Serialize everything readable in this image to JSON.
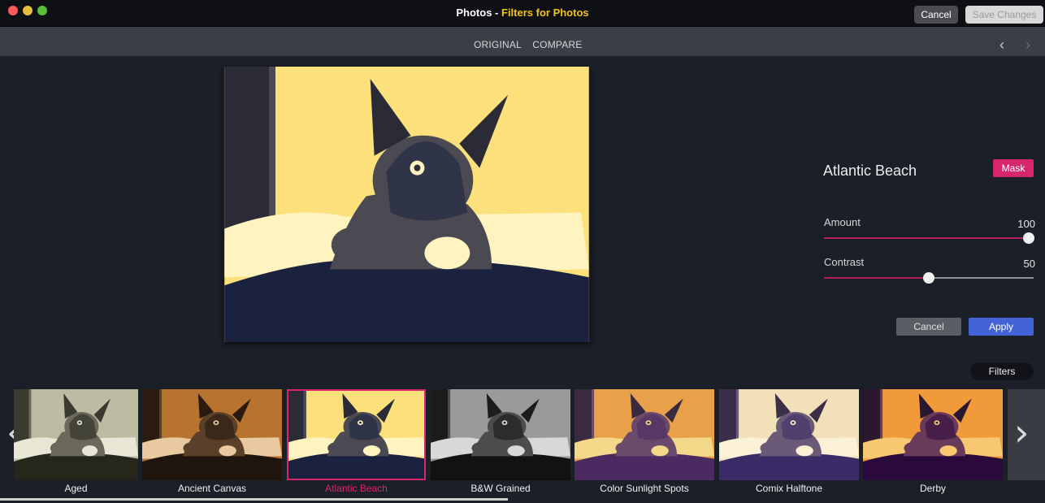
{
  "window": {
    "app_name": "Photos",
    "separator": " - ",
    "plugin_name": "Filters for Photos",
    "cancel_label": "Cancel",
    "save_label": "Save Changes"
  },
  "toolbar": {
    "tab_original": "ORIGINAL",
    "tab_compare": "COMPARE",
    "prev_icon": "‹",
    "next_icon": "›"
  },
  "panel": {
    "filter_name": "Atlantic Beach",
    "mask_label": "Mask",
    "amount": {
      "label": "Amount",
      "value": "100",
      "level": 1.0
    },
    "contrast": {
      "label": "Contrast",
      "value": "50",
      "level": 0.5
    },
    "cancel_label": "Cancel",
    "apply_label": "Apply"
  },
  "filters_label": "Filters",
  "strip": {
    "left_icon": "‹",
    "right_icon": "›",
    "items": [
      {
        "label": "Aged",
        "style": "aged"
      },
      {
        "label": "Ancient Canvas",
        "style": "canvas"
      },
      {
        "label": "Atlantic Beach",
        "style": "atlantic",
        "selected": true
      },
      {
        "label": "B&W Grained",
        "style": "bw"
      },
      {
        "label": "Color Sunlight Spots",
        "style": "sun"
      },
      {
        "label": "Comix Halftone",
        "style": "comix"
      },
      {
        "label": "Derby",
        "style": "derby"
      }
    ]
  },
  "colors": {
    "accent_pink": "#d6266c",
    "apply_blue": "#4463d6",
    "title_yellow": "#f2c318"
  }
}
